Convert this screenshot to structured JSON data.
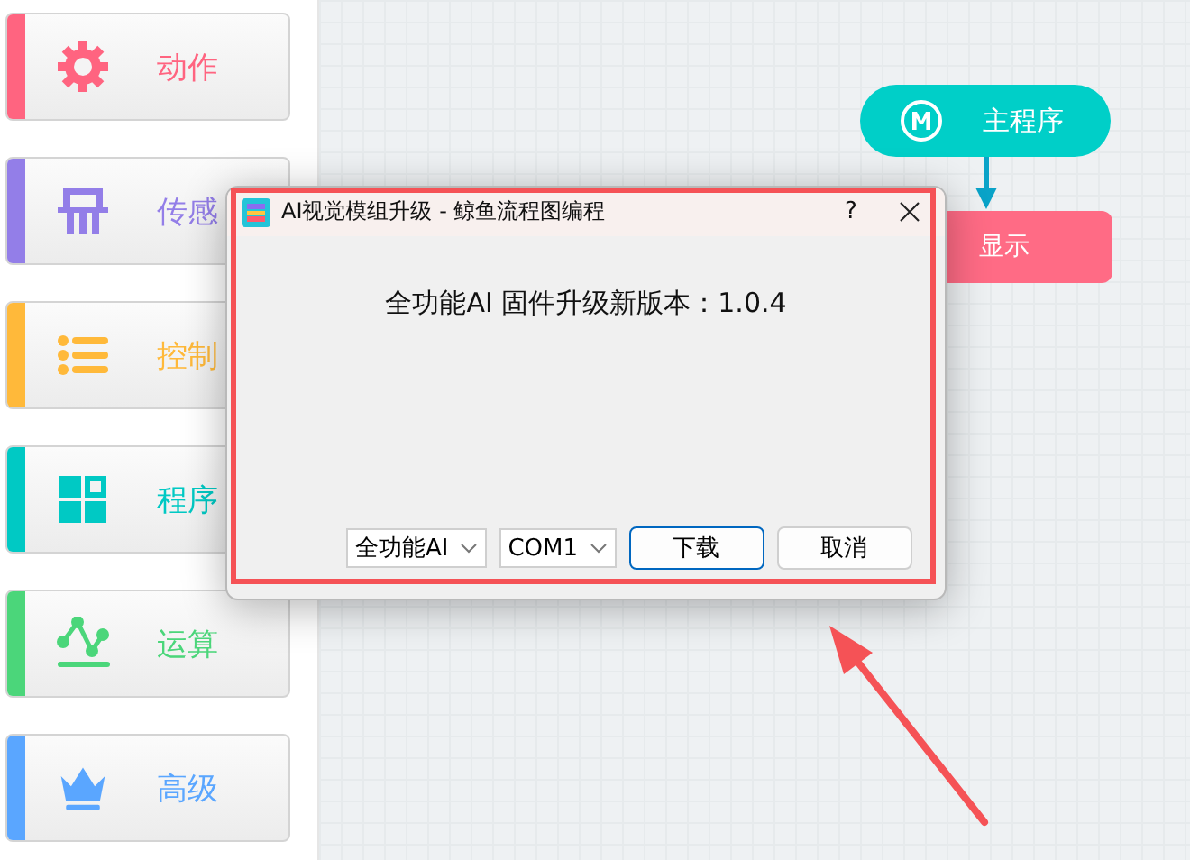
{
  "sidebar": {
    "items": [
      {
        "label": "动作",
        "color": "#ff6480"
      },
      {
        "label": "传感",
        "color": "#937ee8"
      },
      {
        "label": "控制",
        "color": "#ffb93a"
      },
      {
        "label": "程序",
        "color": "#00c9c4"
      },
      {
        "label": "运算",
        "color": "#4bd67a"
      },
      {
        "label": "高级",
        "color": "#5aa6ff"
      }
    ]
  },
  "canvas": {
    "nodes": [
      {
        "kind": "start",
        "label": "主程序"
      },
      {
        "kind": "block",
        "label": "显示"
      }
    ]
  },
  "dialog": {
    "title": "AI视觉模组升级 - 鲸鱼流程图编程",
    "help": "?",
    "message": "全功能AI 固件升级新版本：1.0.4",
    "selects": [
      {
        "value": "全功能AI"
      },
      {
        "value": "COM1"
      }
    ],
    "buttons": [
      {
        "label": "下载",
        "kind": "default"
      },
      {
        "label": "取消",
        "kind": "normal"
      }
    ]
  }
}
